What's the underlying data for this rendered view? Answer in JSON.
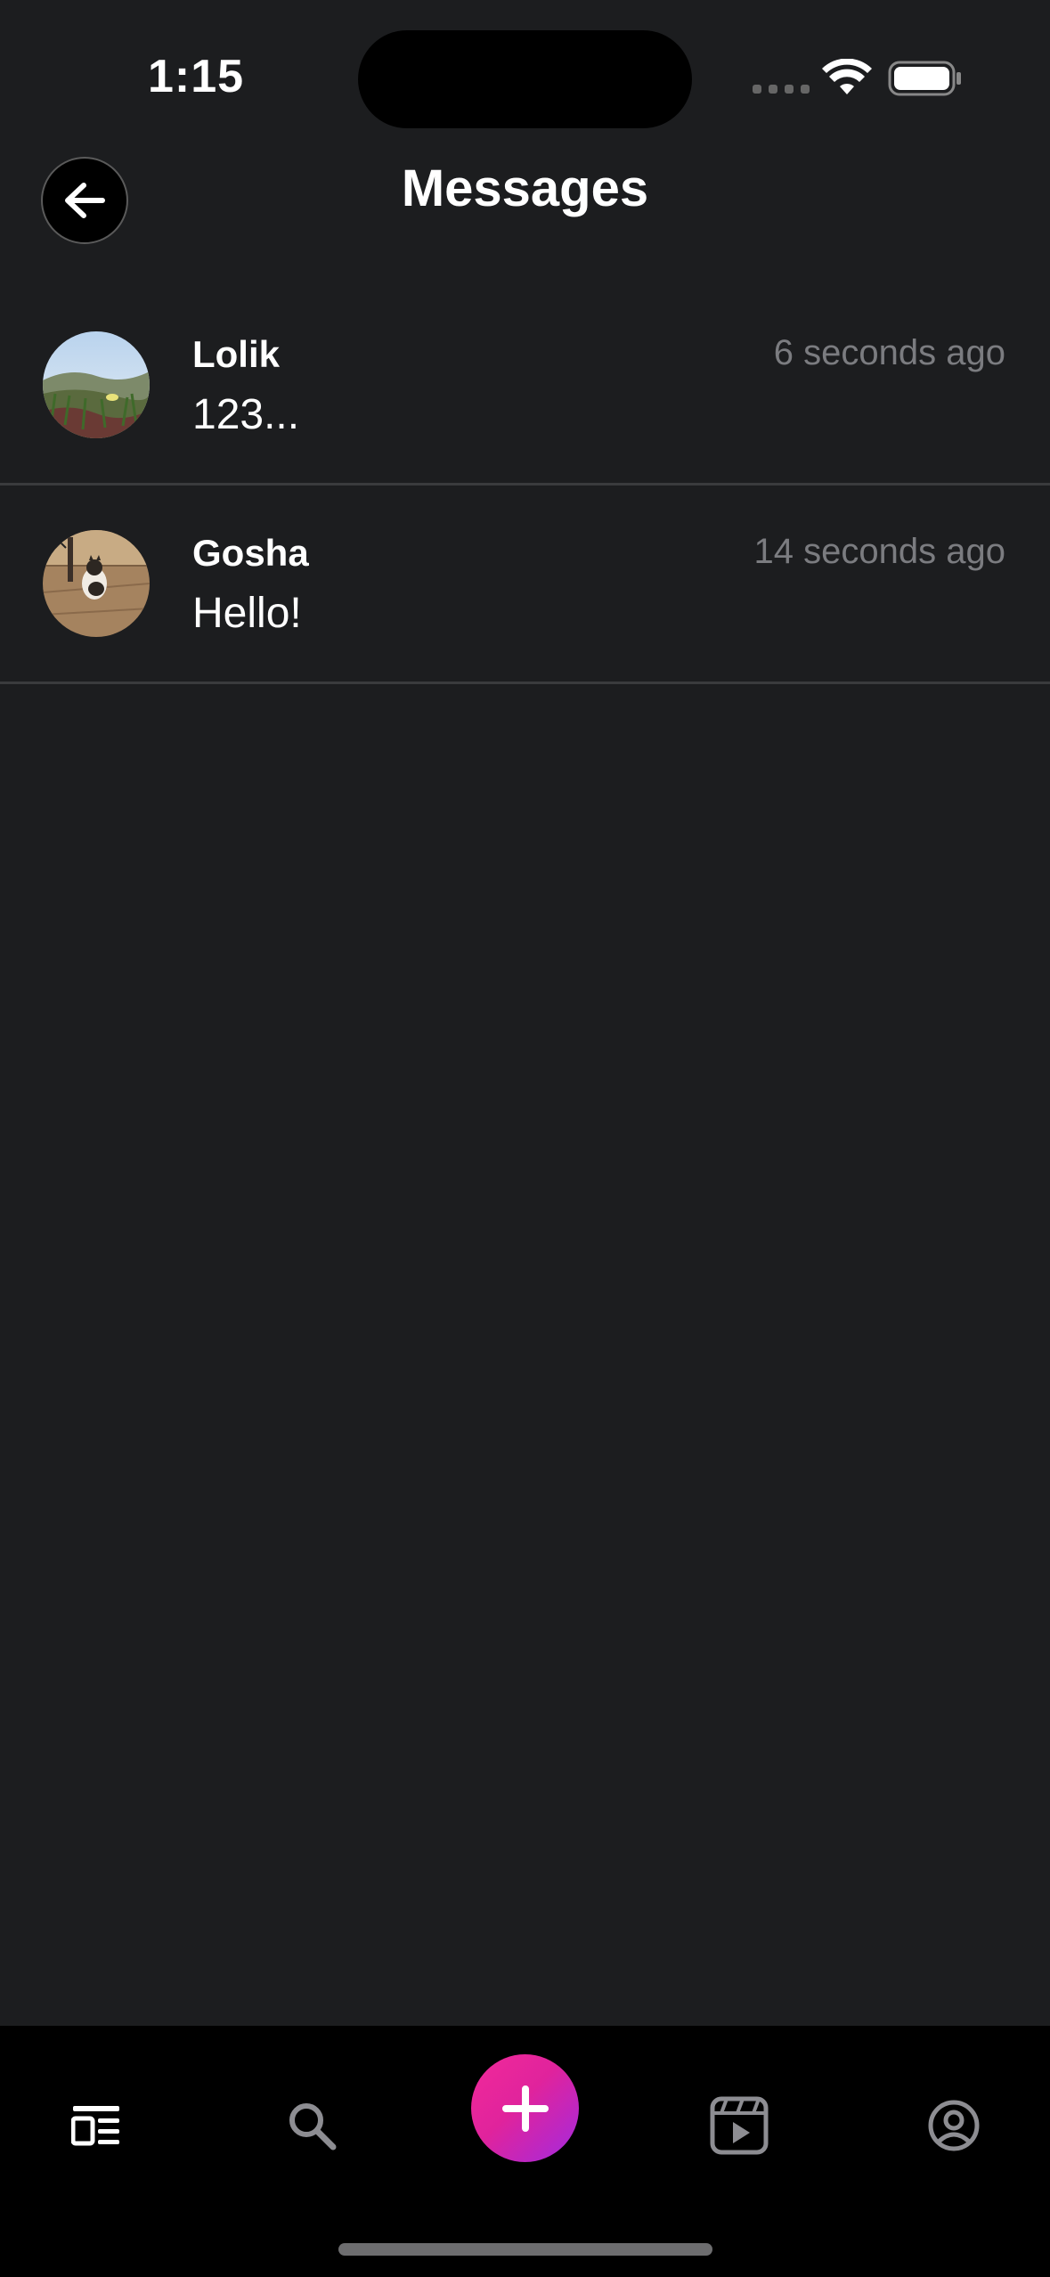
{
  "status_bar": {
    "time": "1:15"
  },
  "header": {
    "title": "Messages",
    "back_icon": "arrow-left-icon"
  },
  "conversations": [
    {
      "name": "Lolik",
      "preview": "123...",
      "time": "6 seconds ago",
      "avatar": "landscape-photo"
    },
    {
      "name": "Gosha",
      "preview": "Hello!",
      "time": "14 seconds ago",
      "avatar": "cat-photo"
    }
  ],
  "tab_bar": {
    "items": [
      {
        "id": "feed",
        "icon": "feed-icon",
        "active": true
      },
      {
        "id": "search",
        "icon": "search-icon",
        "active": false
      },
      {
        "id": "create",
        "icon": "plus-icon",
        "active": false
      },
      {
        "id": "reels",
        "icon": "video-clapper-icon",
        "active": false
      },
      {
        "id": "profile",
        "icon": "user-circle-icon",
        "active": false
      }
    ]
  },
  "colors": {
    "background": "#1c1d1f",
    "tab_bar": "#000000",
    "accent_gradient_start": "#f22a9a",
    "accent_gradient_end": "#a22ae0",
    "muted_text": "#7b7c80",
    "divider": "#3a3b3d"
  }
}
